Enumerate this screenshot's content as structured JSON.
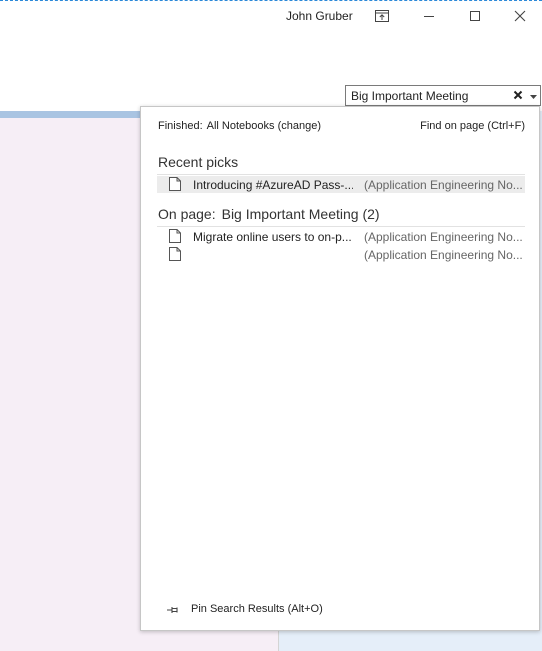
{
  "titlebar": {
    "user_name": "John Gruber",
    "buttons": [
      {
        "icon": "ribbon-display-options-icon"
      },
      {
        "icon": "minimize-icon"
      },
      {
        "icon": "maximize-icon"
      },
      {
        "icon": "close-icon"
      }
    ]
  },
  "search": {
    "value": "Big Important Meeting",
    "clear_icon": "clear-x-icon",
    "scope_icon": "chevron-down-icon"
  },
  "dropdown": {
    "status_label": "Finished:",
    "scope": "All Notebooks",
    "change_label": "(change)",
    "find_on_page": "Find on page (Ctrl+F)",
    "recent": {
      "title": "Recent picks",
      "items": [
        {
          "title": "Introducing #AzureAD Pass-...",
          "location": "(Application Engineering No...",
          "selected": true
        }
      ]
    },
    "on_page": {
      "label": "On page:",
      "page_name": "Big Important Meeting",
      "count": "(2)",
      "items": [
        {
          "title": "Migrate online users to on-p...",
          "location": "(Application Engineering No..."
        },
        {
          "title": "",
          "location": "(Application Engineering No..."
        }
      ]
    },
    "pin_label": "Pin Search Results (Alt+O)"
  },
  "colors": {
    "accent": "#2b88d8",
    "left_pane": "#f6eef6",
    "right_pane": "#e5eef9",
    "selected_row": "#ececec"
  }
}
